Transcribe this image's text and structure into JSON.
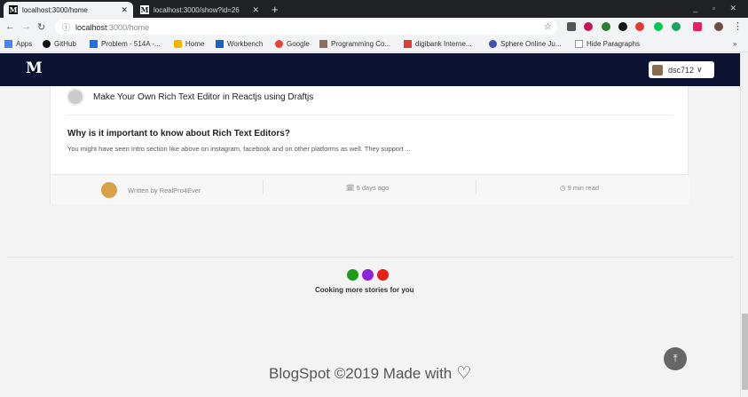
{
  "browser": {
    "tabs": [
      {
        "title": "localhost:3000/home",
        "favicon": "M",
        "active": true
      },
      {
        "title": "localhost:3000/show?id=26",
        "favicon": "M",
        "active": false
      }
    ],
    "new_tab": "+",
    "close": "✕",
    "url_host": "localhost",
    "url_path": ":3000/home",
    "window_controls": "_ ▫ ✕"
  },
  "bookmarks": [
    {
      "label": "Apps",
      "icon": "apps-grid-icon",
      "color": "#4285f4"
    },
    {
      "label": "GitHub",
      "icon": "github-icon",
      "color": "#111111"
    },
    {
      "label": "Problem - 514A -...",
      "icon": "codeforces-icon",
      "color": "#1a73e8"
    },
    {
      "label": "Home",
      "icon": "home-bookmark-icon",
      "color": "#f4b400"
    },
    {
      "label": "Workbench",
      "icon": "workbench-icon",
      "color": "#1565c0"
    },
    {
      "label": "Google",
      "icon": "google-icon",
      "color": "#ea4335"
    },
    {
      "label": "Programming Co...",
      "icon": "codechef-icon",
      "color": "#8d6e63"
    },
    {
      "label": "digibank Interne...",
      "icon": "digibank-icon",
      "color": "#e53935"
    },
    {
      "label": "Sphere Online Ju...",
      "icon": "spoj-icon",
      "color": "#3f51b5"
    },
    {
      "label": "Hide Paragraphs",
      "icon": "page-icon",
      "color": "#888888"
    }
  ],
  "header": {
    "logo": "M",
    "user": "dsc712",
    "chevron": "∨"
  },
  "card": {
    "author_line": "Make Your Own Rich Text Editor in Reactjs using Draftjs",
    "title": "Why is it important to know about Rich Text Editors?",
    "excerpt": "You might have seen Intro section like above on instagram, facebook and on other platforms as well. They support ...",
    "written_by": "Written by RealPro4Ever",
    "date": "5 days ago",
    "read_time": "9 min read",
    "calendar_icon": "🗓",
    "clock_icon": "◷"
  },
  "loader": {
    "text": "Cooking more stories for you",
    "dot_colors": [
      "#1a9e1a",
      "#8e24d6",
      "#e62117"
    ]
  },
  "footer": {
    "text": "BlogSpot ©2019 Made with",
    "heart": "♡"
  },
  "to_top": "⤒",
  "colors": {
    "header_bg": "#0c1231",
    "page_bg": "#f3f3f3"
  }
}
